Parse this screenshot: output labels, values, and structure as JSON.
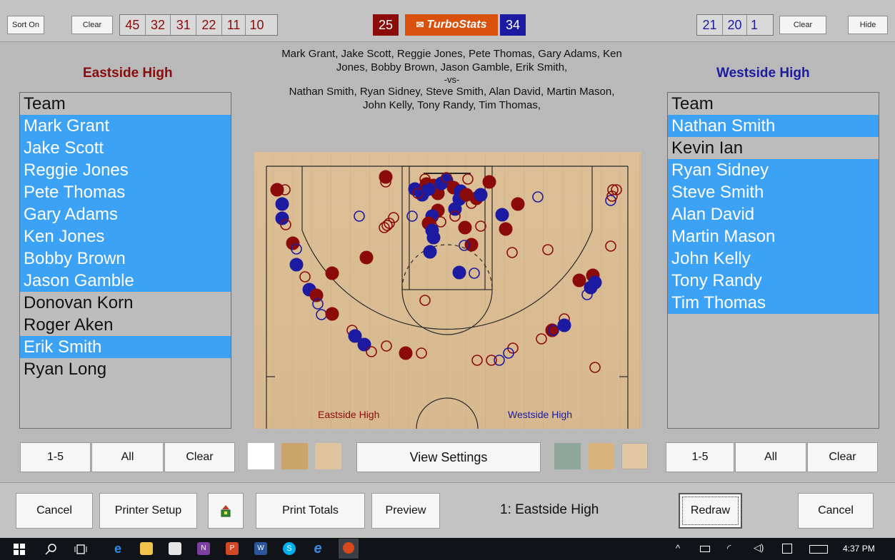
{
  "topbar": {
    "sort_label": "Sort On",
    "clear_left_label": "Clear",
    "left_quarters": [
      "45",
      "32",
      "31",
      "22",
      "11",
      "10"
    ],
    "home_score": "25",
    "logo_text": "TurboStats",
    "away_score": "34",
    "right_quarters": [
      "21",
      "20",
      "1"
    ],
    "clear_right_label": "Clear",
    "hide_label": "Hide"
  },
  "home": {
    "name": "Eastside High",
    "color": "#8b0b0b",
    "roster": [
      {
        "name": "Team",
        "selected": false
      },
      {
        "name": "Mark Grant",
        "selected": true
      },
      {
        "name": "Jake Scott",
        "selected": true
      },
      {
        "name": "Reggie Jones",
        "selected": true
      },
      {
        "name": "Pete Thomas",
        "selected": true
      },
      {
        "name": "Gary Adams",
        "selected": true
      },
      {
        "name": "Ken Jones",
        "selected": true
      },
      {
        "name": "Bobby Brown",
        "selected": true
      },
      {
        "name": "Jason Gamble",
        "selected": true
      },
      {
        "name": "Donovan Korn",
        "selected": false
      },
      {
        "name": "Roger Aken",
        "selected": false
      },
      {
        "name": "Erik Smith",
        "selected": true
      },
      {
        "name": "Ryan Long",
        "selected": false
      }
    ]
  },
  "away": {
    "name": "Westside High",
    "color": "#1c1aa0",
    "roster": [
      {
        "name": "Team",
        "selected": false
      },
      {
        "name": "Nathan Smith",
        "selected": true
      },
      {
        "name": "Kevin Ian",
        "selected": false
      },
      {
        "name": "Ryan Sidney",
        "selected": true
      },
      {
        "name": "Steve Smith",
        "selected": true
      },
      {
        "name": "Alan David",
        "selected": true
      },
      {
        "name": "Martin Mason",
        "selected": true
      },
      {
        "name": "John Kelly",
        "selected": true
      },
      {
        "name": "Tony Randy",
        "selected": true
      },
      {
        "name": "Tim Thomas",
        "selected": true
      }
    ]
  },
  "matchup": {
    "home_line1": "Mark Grant, Jake Scott, Reggie Jones, Pete Thomas, Gary Adams, Ken",
    "home_line2": "Jones, Bobby Brown, Jason Gamble, Erik Smith,",
    "vs": "-vs-",
    "away_line1": "Nathan Smith, Ryan Sidney, Steve Smith, Alan David, Martin Mason,",
    "away_line2": "John Kelly, Tony Randy, Tim Thomas,"
  },
  "court": {
    "home_label": "Eastside High",
    "away_label": "Westside High",
    "shot_count_note": "made shots filled, missed shots open"
  },
  "controls": {
    "left": {
      "range_label": "1-5",
      "all_label": "All",
      "clear_label": "Clear"
    },
    "view_settings_label": "View Settings",
    "right": {
      "range_label": "1-5",
      "all_label": "All",
      "clear_label": "Clear"
    },
    "swatches_left": [
      "#ffffff",
      "#c9a56c",
      "#dfc39d"
    ],
    "swatches_right": [
      "#8fa79a",
      "#d8b47c",
      "#e2c9a3"
    ]
  },
  "bottombar": {
    "cancel_left_label": "Cancel",
    "printer_setup_label": "Printer Setup",
    "print_totals_label": "Print Totals",
    "preview_label": "Preview",
    "status_text": "1: Eastside High",
    "redraw_label": "Redraw",
    "cancel_right_label": "Cancel"
  },
  "taskbar": {
    "clock": "4:37 PM"
  }
}
